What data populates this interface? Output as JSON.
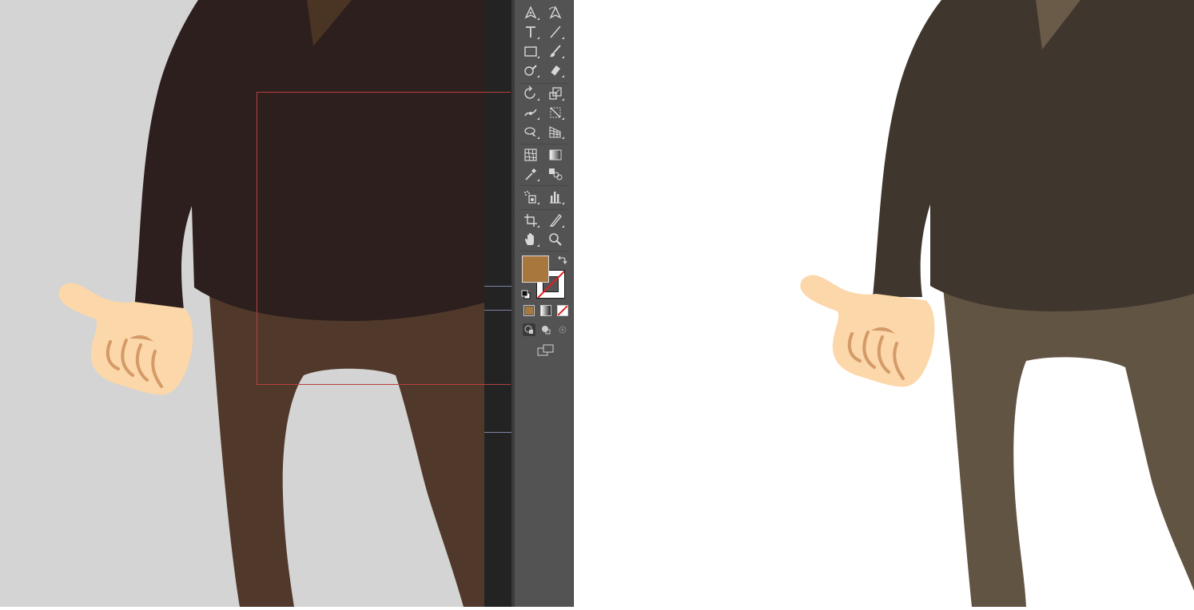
{
  "app": {
    "window_title": ""
  },
  "colors": {
    "pasteboard": "#d4d4d4",
    "artboard": "#ffffff",
    "toolbar_bg": "#535353",
    "ruler_bg": "#232323",
    "ruler_tick": "#7f85a8",
    "selection_outline": "#b8403f",
    "sweater_left": "#2c1f1d",
    "pants_left": "#50392a",
    "sweater_right": "#3f362d",
    "pants_right": "#625443",
    "skin": "#fcd7a9",
    "skin_line": "#d49a68",
    "fill_color": "#a8773e"
  },
  "tools": [
    {
      "name": "pen-tool-icon",
      "row": 0,
      "col": 0,
      "group": true
    },
    {
      "name": "curvature-tool-icon",
      "row": 0,
      "col": 1,
      "group": false
    },
    {
      "name": "type-tool-icon",
      "row": 1,
      "col": 0,
      "group": true
    },
    {
      "name": "line-segment-tool-icon",
      "row": 1,
      "col": 1,
      "group": true
    },
    {
      "name": "rectangle-tool-icon",
      "row": 2,
      "col": 0,
      "group": true
    },
    {
      "name": "paintbrush-tool-icon",
      "row": 2,
      "col": 1,
      "group": true
    },
    {
      "name": "shaper-tool-icon",
      "row": 3,
      "col": 0,
      "group": true
    },
    {
      "name": "eraser-tool-icon",
      "row": 3,
      "col": 1,
      "group": true
    },
    {
      "name": "rotate-tool-icon",
      "row": 4,
      "col": 0,
      "group": true
    },
    {
      "name": "scale-tool-icon",
      "row": 4,
      "col": 1,
      "group": true
    },
    {
      "name": "width-tool-icon",
      "row": 5,
      "col": 0,
      "group": true
    },
    {
      "name": "free-transform-tool-icon",
      "row": 5,
      "col": 1,
      "group": true
    },
    {
      "name": "shape-builder-tool-icon",
      "row": 6,
      "col": 0,
      "group": true
    },
    {
      "name": "perspective-grid-tool-icon",
      "row": 6,
      "col": 1,
      "group": true
    },
    {
      "name": "mesh-tool-icon",
      "row": 7,
      "col": 0,
      "group": false
    },
    {
      "name": "gradient-tool-icon",
      "row": 7,
      "col": 1,
      "group": false
    },
    {
      "name": "eyedropper-tool-icon",
      "row": 8,
      "col": 0,
      "group": true
    },
    {
      "name": "blend-tool-icon",
      "row": 8,
      "col": 1,
      "group": false
    },
    {
      "name": "symbol-sprayer-tool-icon",
      "row": 9,
      "col": 0,
      "group": true
    },
    {
      "name": "column-graph-tool-icon",
      "row": 9,
      "col": 1,
      "group": true
    },
    {
      "name": "artboard-tool-icon",
      "row": 10,
      "col": 0,
      "group": true
    },
    {
      "name": "slice-tool-icon",
      "row": 10,
      "col": 1,
      "group": true
    },
    {
      "name": "hand-tool-icon",
      "row": 11,
      "col": 0,
      "group": true
    },
    {
      "name": "zoom-tool-icon",
      "row": 11,
      "col": 1,
      "group": false
    }
  ]
}
